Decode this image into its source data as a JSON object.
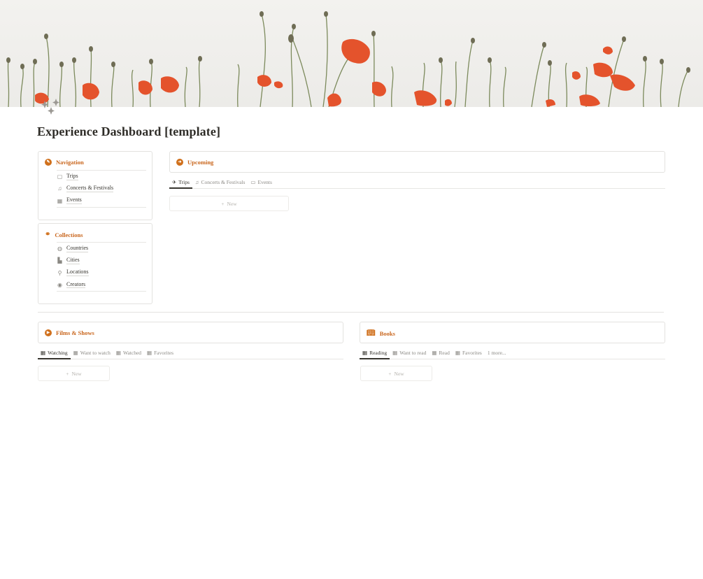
{
  "page": {
    "title": "Experience Dashboard [template]",
    "accent_color": "#d0701c",
    "cover_image": "red poppies on white background",
    "page_icon": "sparkle-icon"
  },
  "navigation": {
    "title": "Navigation",
    "icon": "compass-icon",
    "items": [
      {
        "label": "Trips",
        "icon": "notebook-icon"
      },
      {
        "label": "Concerts & Festivals",
        "icon": "music-note-icon"
      },
      {
        "label": "Events",
        "icon": "calendar-folder-icon"
      }
    ]
  },
  "collections": {
    "title": "Collections",
    "icon": "link-icon",
    "items": [
      {
        "label": "Countries",
        "icon": "globe-icon"
      },
      {
        "label": "Cities",
        "icon": "city-icon"
      },
      {
        "label": "Locations",
        "icon": "map-pin-icon"
      },
      {
        "label": "Creators",
        "icon": "person-icon"
      }
    ]
  },
  "upcoming": {
    "title": "Upcoming",
    "icon": "arrow-circle-icon",
    "tabs": [
      {
        "label": "Trips",
        "icon": "airplane-icon",
        "active": true
      },
      {
        "label": "Concerts & Festivals",
        "icon": "music-note-icon",
        "active": false
      },
      {
        "label": "Events",
        "icon": "calendar-icon",
        "active": false
      }
    ],
    "new_label": "New"
  },
  "films": {
    "title": "Films & Shows",
    "icon": "play-circle-icon",
    "tabs": [
      {
        "label": "Watching",
        "icon": "gallery-icon",
        "active": true
      },
      {
        "label": "Want to watch",
        "icon": "gallery-icon",
        "active": false
      },
      {
        "label": "Watched",
        "icon": "gallery-icon",
        "active": false
      },
      {
        "label": "Favorites",
        "icon": "gallery-icon",
        "active": false
      }
    ],
    "new_label": "New"
  },
  "books": {
    "title": "Books",
    "icon": "open-book-icon",
    "tabs": [
      {
        "label": "Reading",
        "icon": "gallery-icon",
        "active": true
      },
      {
        "label": "Want to read",
        "icon": "gallery-icon",
        "active": false
      },
      {
        "label": "Read",
        "icon": "gallery-icon",
        "active": false
      },
      {
        "label": "Favorites",
        "icon": "gallery-icon",
        "active": false
      }
    ],
    "more_label": "1 more...",
    "new_label": "New"
  }
}
